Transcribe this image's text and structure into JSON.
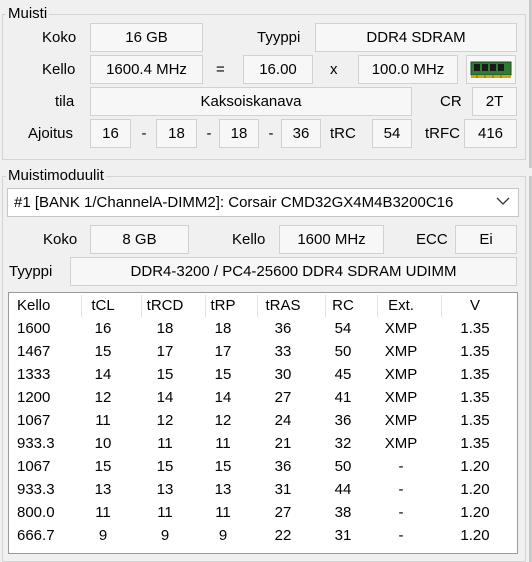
{
  "memory": {
    "title": "Muisti",
    "size_label": "Koko",
    "size_value": "16 GB",
    "type_label": "Tyyppi",
    "type_value": "DDR4 SDRAM",
    "clock_label": "Kello",
    "clock_value": "1600.4 MHz",
    "equals": "=",
    "multiplier": "16.00",
    "times": "x",
    "bus_clock": "100.0 MHz",
    "mode_label": "tila",
    "mode_value": "Kaksoiskanava",
    "cr_label": "CR",
    "cr_value": "2T",
    "timing_label": "Ajoitus",
    "timings": [
      "16",
      "18",
      "18",
      "36"
    ],
    "dash": "-",
    "trc_label": "tRC",
    "trc_value": "54",
    "trfc_label": "tRFC",
    "trfc_value": "416",
    "ram_icon": "ram-module-icon"
  },
  "modules": {
    "title": "Muistimoduulit",
    "selected": "#1 [BANK 1/ChannelA-DIMM2]: Corsair CMD32GX4M4B3200C16",
    "size_label": "Koko",
    "size_value": "8 GB",
    "clock_label": "Kello",
    "clock_value": "1600 MHz",
    "ecc_label": "ECC",
    "ecc_value": "Ei",
    "type_label": "Tyyppi",
    "type_value": "DDR4-3200 / PC4-25600 DDR4 SDRAM UDIMM"
  },
  "timing_table": {
    "headers": [
      "Kello",
      "tCL",
      "tRCD",
      "tRP",
      "tRAS",
      "RC",
      "Ext.",
      "V"
    ],
    "rows": [
      [
        "1600",
        "16",
        "18",
        "18",
        "36",
        "54",
        "XMP",
        "1.35"
      ],
      [
        "1467",
        "15",
        "17",
        "17",
        "33",
        "50",
        "XMP",
        "1.35"
      ],
      [
        "1333",
        "14",
        "15",
        "15",
        "30",
        "45",
        "XMP",
        "1.35"
      ],
      [
        "1200",
        "12",
        "14",
        "14",
        "27",
        "41",
        "XMP",
        "1.35"
      ],
      [
        "1067",
        "11",
        "12",
        "12",
        "24",
        "36",
        "XMP",
        "1.35"
      ],
      [
        "933.3",
        "10",
        "11",
        "11",
        "21",
        "32",
        "XMP",
        "1.35"
      ],
      [
        "1067",
        "15",
        "15",
        "15",
        "36",
        "50",
        "-",
        "1.20"
      ],
      [
        "933.3",
        "13",
        "13",
        "13",
        "31",
        "44",
        "-",
        "1.20"
      ],
      [
        "800.0",
        "11",
        "11",
        "11",
        "27",
        "38",
        "-",
        "1.20"
      ],
      [
        "666.7",
        "9",
        "9",
        "9",
        "22",
        "31",
        "-",
        "1.20"
      ]
    ]
  }
}
